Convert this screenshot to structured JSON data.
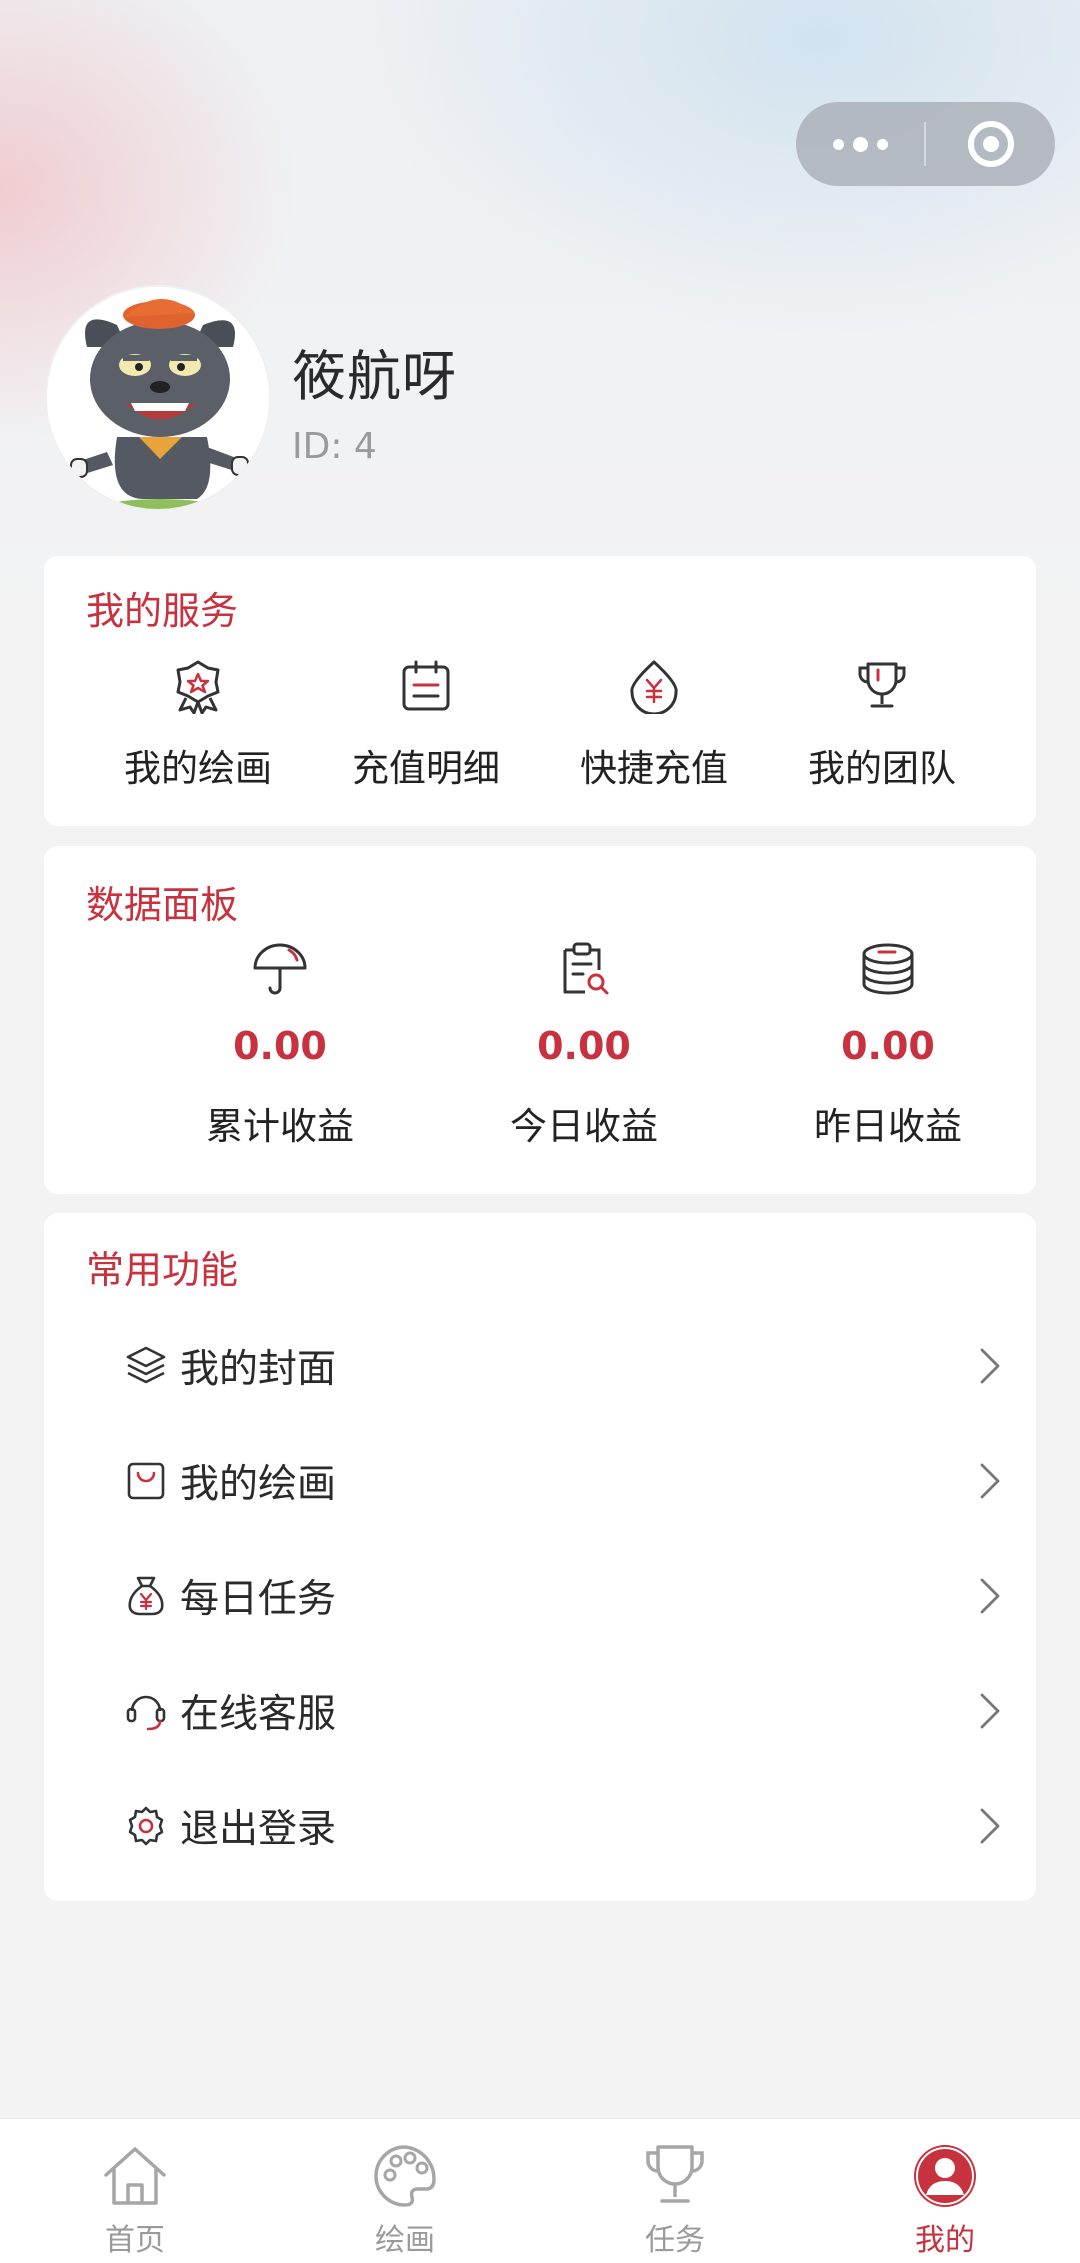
{
  "colors": {
    "accent": "#c8323f",
    "icon_stroke": "#333333",
    "tab_inactive": "#9a9a9a"
  },
  "capsule": {
    "more_icon": "more-dots-icon",
    "close_icon": "target-close-icon"
  },
  "user": {
    "name": "筱航呀",
    "id_text": "ID: 4",
    "avatar_icon": "cartoon-wolf-avatar"
  },
  "services": {
    "title": "我的服务",
    "items": [
      {
        "label": "我的绘画",
        "icon": "badge-star-icon"
      },
      {
        "label": "充值明细",
        "icon": "calendar-list-icon"
      },
      {
        "label": "快捷充值",
        "icon": "yuan-drop-icon"
      },
      {
        "label": "我的团队",
        "icon": "trophy-icon"
      }
    ]
  },
  "dashboard": {
    "title": "数据面板",
    "items": [
      {
        "value": "0.00",
        "label": "累计收益",
        "icon": "umbrella-icon"
      },
      {
        "value": "0.00",
        "label": "今日收益",
        "icon": "clipboard-search-icon"
      },
      {
        "value": "0.00",
        "label": "昨日收益",
        "icon": "coins-stack-icon"
      }
    ]
  },
  "functions": {
    "title": "常用功能",
    "items": [
      {
        "label": "我的封面",
        "icon": "layers-icon"
      },
      {
        "label": "我的绘画",
        "icon": "bag-icon"
      },
      {
        "label": "每日任务",
        "icon": "money-bag-icon"
      },
      {
        "label": "在线客服",
        "icon": "headset-icon"
      },
      {
        "label": "退出登录",
        "icon": "gear-icon"
      }
    ]
  },
  "tabbar": {
    "items": [
      {
        "label": "首页",
        "icon": "home-icon",
        "active": false
      },
      {
        "label": "绘画",
        "icon": "palette-icon",
        "active": false
      },
      {
        "label": "任务",
        "icon": "trophy-cup-icon",
        "active": false
      },
      {
        "label": "我的",
        "icon": "user-circle-icon",
        "active": true
      }
    ]
  }
}
